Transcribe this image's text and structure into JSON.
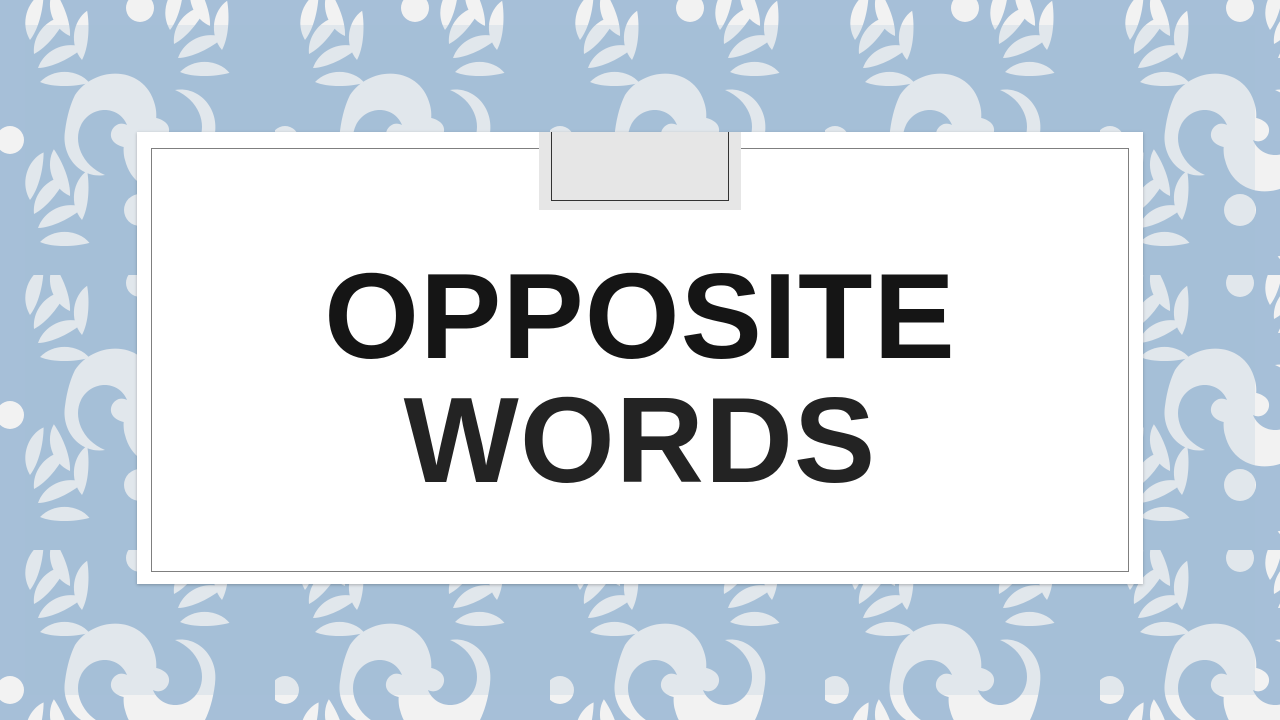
{
  "slide": {
    "title_line1": "OPPOSITE",
    "title_line2": "WORDS"
  },
  "colors": {
    "background": "#a6bfd8",
    "pattern": "#f2f2f2",
    "card": "#ffffff",
    "text": "#151515"
  },
  "icons": {
    "pattern_motifs": [
      "leaf-sprig-icon",
      "paisley-swirl-icon",
      "dot-icon"
    ]
  }
}
